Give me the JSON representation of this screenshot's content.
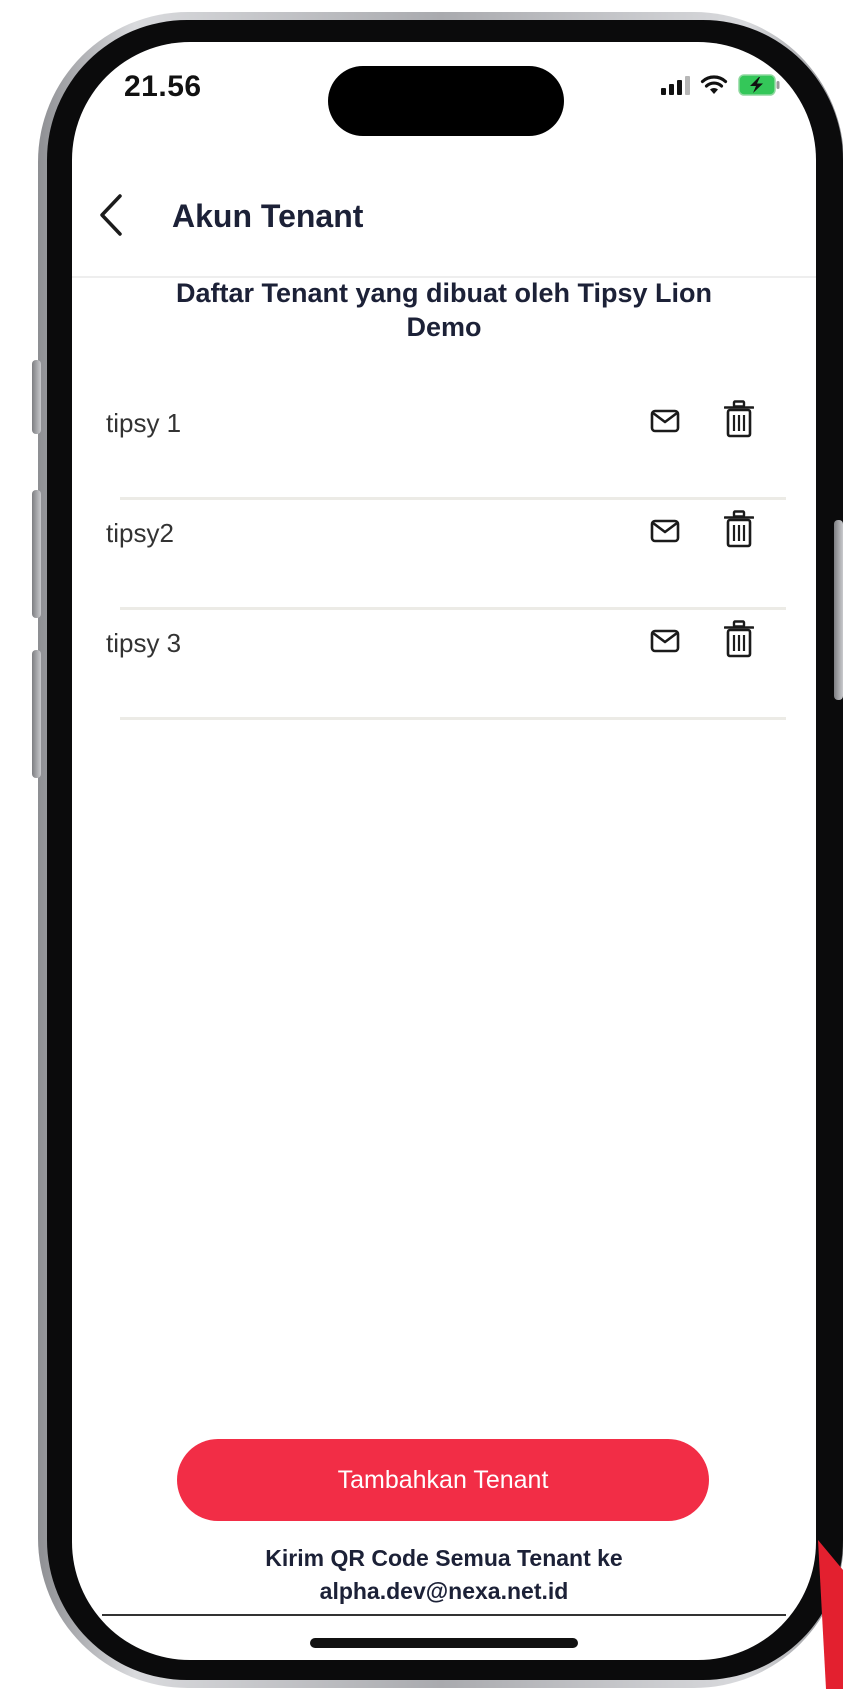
{
  "status_bar": {
    "time": "21.56",
    "icons": [
      "signal-icon",
      "wifi-icon",
      "battery-charging-icon"
    ]
  },
  "header": {
    "back_icon": "chevron-left-icon",
    "title": "Akun Tenant"
  },
  "main": {
    "heading": "Daftar Tenant yang dibuat oleh Tipsy Lion Demo",
    "tenants": [
      {
        "name": "tipsy 1",
        "actions": [
          "mail-icon",
          "trash-icon"
        ]
      },
      {
        "name": "tipsy2",
        "actions": [
          "mail-icon",
          "trash-icon"
        ]
      },
      {
        "name": "tipsy 3",
        "actions": [
          "mail-icon",
          "trash-icon"
        ]
      }
    ]
  },
  "footer": {
    "add_button_label": "Tambahkan Tenant",
    "send_qr_label": "Kirim QR Code Semua Tenant ke alpha.dev@nexa.net.id"
  },
  "colors": {
    "primary_button": "#f22d46",
    "heading_text": "#1c2137",
    "row_divider": "#ecebe6"
  }
}
